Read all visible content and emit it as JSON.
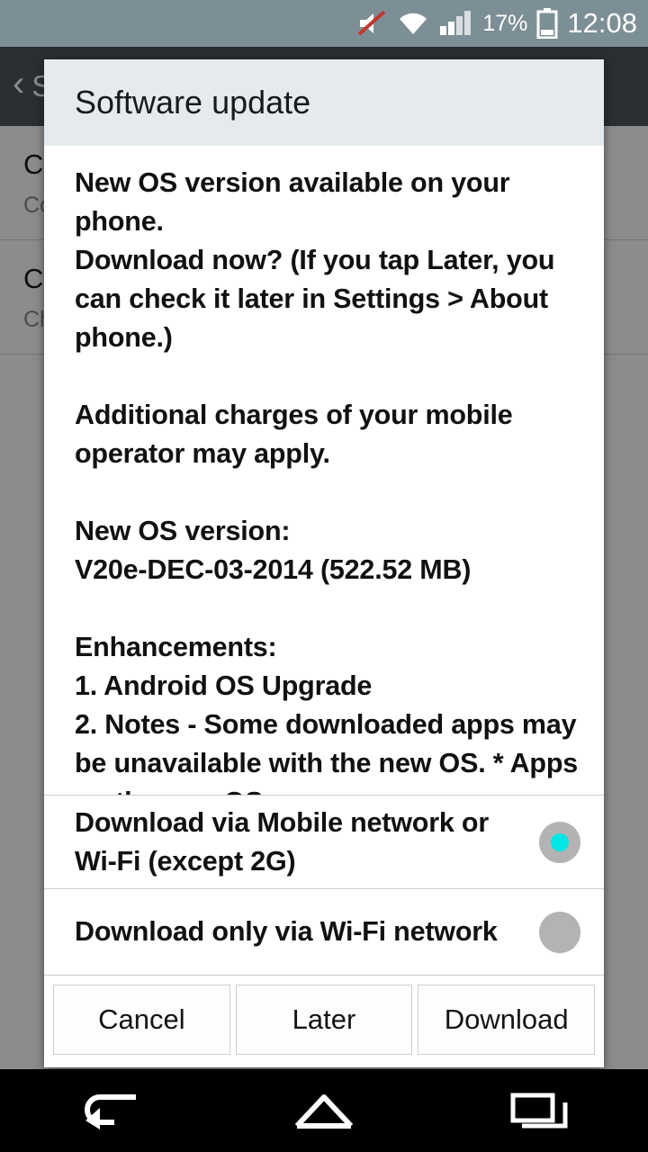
{
  "status_bar": {
    "battery_percent": "17%",
    "clock": "12:08",
    "icons": [
      "mute-icon",
      "wifi-icon",
      "signal-icon",
      "battery-icon"
    ]
  },
  "background_page": {
    "back_label": "S",
    "rows": [
      {
        "title": "C",
        "subtitle": "Co"
      },
      {
        "title": "C\nau",
        "subtitle": "Ch\ndo\nup"
      }
    ]
  },
  "dialog": {
    "title": "Software update",
    "message_paragraphs": [
      "New OS version available on your phone.\nDownload now? (If you tap Later, you can check it later in Settings > About phone.)",
      "Additional charges of your mobile operator may apply.",
      "New OS version:\nV20e-DEC-03-2014 (522.52 MB)",
      "Enhancements:\n1. Android OS Upgrade\n2. Notes - Some downloaded apps may be unavailable with the new OS. * Apps on the new OS"
    ],
    "options": [
      {
        "label": "Download via Mobile network or Wi-Fi (except 2G)",
        "selected": true
      },
      {
        "label": "Download only via Wi-Fi network",
        "selected": false
      }
    ],
    "buttons": [
      {
        "label": "Cancel"
      },
      {
        "label": "Later"
      },
      {
        "label": "Download"
      }
    ],
    "accent_color": "#00e5e5",
    "header_color": "#e4eaee"
  },
  "nav_bar": {
    "items": [
      "back-icon",
      "home-icon",
      "recents-icon"
    ]
  }
}
